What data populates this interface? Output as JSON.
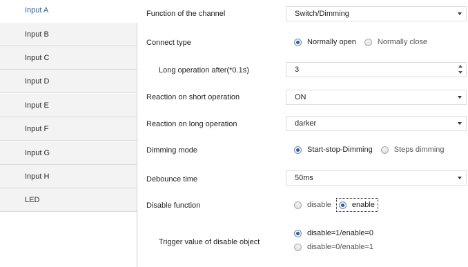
{
  "sidebar": {
    "items": [
      {
        "label": "Input A"
      },
      {
        "label": "Input B"
      },
      {
        "label": "Input C"
      },
      {
        "label": "Input D"
      },
      {
        "label": "Input E"
      },
      {
        "label": "Input F"
      },
      {
        "label": "Input G"
      },
      {
        "label": "Input H"
      },
      {
        "label": "LED"
      }
    ],
    "active_index": 0
  },
  "settings": {
    "function_channel": {
      "label": "Function of the channel",
      "value": "Switch/Dimming"
    },
    "connect_type": {
      "label": "Connect type",
      "options": [
        "Normally open",
        "Normally close"
      ],
      "selected": "Normally open"
    },
    "long_operation": {
      "label": "Long operation after(*0.1s)",
      "value": "3"
    },
    "reaction_short": {
      "label": "Reaction on short operation",
      "value": "ON"
    },
    "reaction_long": {
      "label": "Reaction on long operation",
      "value": "darker"
    },
    "dimming_mode": {
      "label": "Dimming mode",
      "options": [
        "Start-stop-Dimming",
        "Steps dimming"
      ],
      "selected": "Start-stop-Dimming"
    },
    "debounce_time": {
      "label": "Debounce time",
      "value": "50ms"
    },
    "disable_function": {
      "label": "Disable function",
      "options": [
        "disable",
        "enable"
      ],
      "selected": "enable"
    },
    "trigger_value": {
      "label": "Trigger value of disable object",
      "options": [
        "disable=1/enable=0",
        "disable=0/enable=1"
      ],
      "selected": "disable=1/enable=0"
    }
  },
  "colors": {
    "active_tab_text": "#1f5fa8",
    "sidebar_bg": "#f3f3f3",
    "radio_selected": "#2f5f9c"
  }
}
